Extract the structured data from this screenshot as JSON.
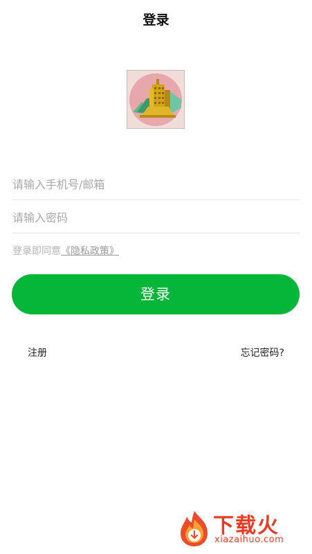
{
  "header": {
    "title": "登录"
  },
  "logo": {
    "icon": "building-logo-icon"
  },
  "form": {
    "account_placeholder": "请输入手机号/邮箱",
    "account_value": "",
    "password_placeholder": "请输入密码",
    "password_value": ""
  },
  "agreement": {
    "prefix": "登录即同意",
    "policy_link": "《隐私政策》"
  },
  "buttons": {
    "login_label": "登录"
  },
  "links": {
    "register": "注册",
    "forgot_password": "忘记密码?"
  },
  "watermark": {
    "title": "下载火",
    "url": "xiazaihuo.com"
  },
  "colors": {
    "accent": "#06b638",
    "watermark": "#ea3a24"
  }
}
